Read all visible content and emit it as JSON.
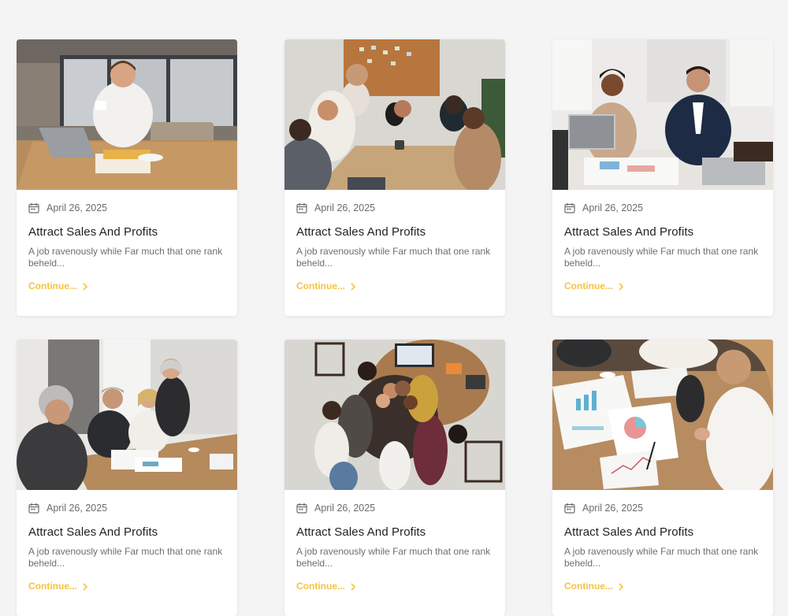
{
  "accent_color": "#f5c342",
  "posts": [
    {
      "image": "man-with-laptop-and-coffee-photo",
      "date_icon": "calendar-icon",
      "date": "April 26, 2025",
      "title": "Attract Sales And Profits",
      "excerpt": "A job ravenously while Far much that one rank beheld...",
      "link": "Continue...",
      "link_icon": "chevron-right-icon"
    },
    {
      "image": "team-handshake-meeting-photo",
      "date_icon": "calendar-icon",
      "date": "April 26, 2025",
      "title": "Attract Sales And Profits",
      "excerpt": "A job ravenously while Far much that one rank beheld...",
      "link": "Continue...",
      "link_icon": "chevron-right-icon"
    },
    {
      "image": "two-colleagues-at-desk-photo",
      "date_icon": "calendar-icon",
      "date": "April 26, 2025",
      "title": "Attract Sales And Profits",
      "excerpt": "A job ravenously while Far much that one rank beheld...",
      "link": "Continue...",
      "link_icon": "chevron-right-icon"
    },
    {
      "image": "boardroom-presentation-photo",
      "date_icon": "calendar-icon",
      "date": "April 26, 2025",
      "title": "Attract Sales And Profits",
      "excerpt": "A job ravenously while Far much that one rank beheld...",
      "link": "Continue...",
      "link_icon": "chevron-right-icon"
    },
    {
      "image": "team-hands-together-overhead-photo",
      "date_icon": "calendar-icon",
      "date": "April 26, 2025",
      "title": "Attract Sales And Profits",
      "excerpt": "A job ravenously while Far much that one rank beheld...",
      "link": "Continue...",
      "link_icon": "chevron-right-icon"
    },
    {
      "image": "charts-on-table-analysis-photo",
      "date_icon": "calendar-icon",
      "date": "April 26, 2025",
      "title": "Attract Sales And Profits",
      "excerpt": "A job ravenously while Far much that one rank beheld...",
      "link": "Continue...",
      "link_icon": "chevron-right-icon"
    }
  ]
}
